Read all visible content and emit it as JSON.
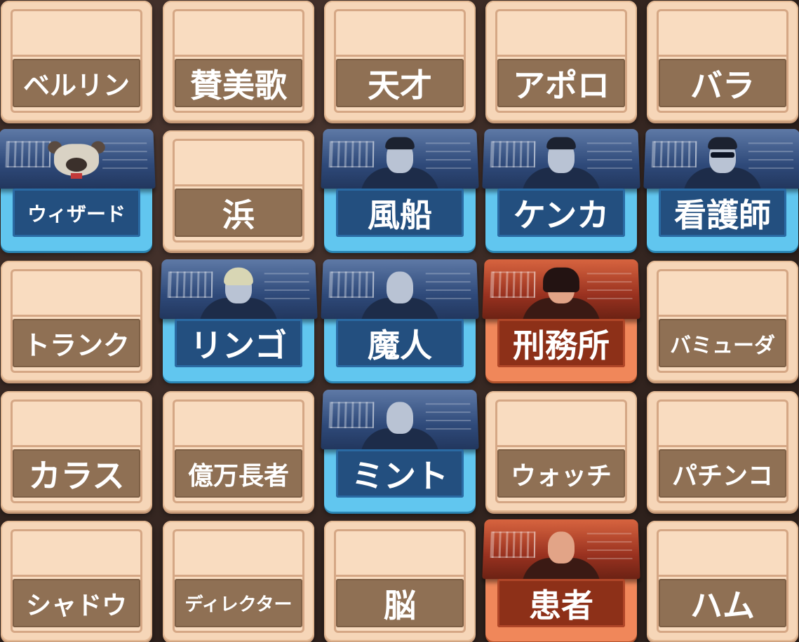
{
  "board": {
    "cards": [
      {
        "word": "ベルリン",
        "type": "neutral",
        "size": 38
      },
      {
        "word": "賛美歌",
        "type": "neutral",
        "size": 46
      },
      {
        "word": "天才",
        "type": "neutral",
        "size": 46
      },
      {
        "word": "アポロ",
        "type": "neutral",
        "size": 46
      },
      {
        "word": "バラ",
        "type": "neutral",
        "size": 46
      },
      {
        "word": "ウィザード",
        "type": "blue",
        "agent": "dog",
        "size": 28
      },
      {
        "word": "浜",
        "type": "neutral",
        "size": 46
      },
      {
        "word": "風船",
        "type": "blue",
        "agent": "man-suit",
        "size": 46
      },
      {
        "word": "ケンカ",
        "type": "blue",
        "agent": "woman-jacket",
        "size": 46
      },
      {
        "word": "看護師",
        "type": "blue",
        "agent": "man-shades",
        "size": 46
      },
      {
        "word": "トランク",
        "type": "neutral",
        "size": 38
      },
      {
        "word": "リンゴ",
        "type": "blue",
        "agent": "blonde-woman",
        "size": 46
      },
      {
        "word": "魔人",
        "type": "blue",
        "agent": "old-man",
        "size": 46
      },
      {
        "word": "刑務所",
        "type": "red",
        "agent": "bob-woman",
        "size": 46
      },
      {
        "word": "バミューダ",
        "type": "neutral",
        "size": 30
      },
      {
        "word": "カラス",
        "type": "neutral",
        "size": 46
      },
      {
        "word": "億万長者",
        "type": "neutral",
        "size": 36
      },
      {
        "word": "ミント",
        "type": "blue",
        "agent": "bald-man",
        "size": 46
      },
      {
        "word": "ウォッチ",
        "type": "neutral",
        "size": 36
      },
      {
        "word": "パチンコ",
        "type": "neutral",
        "size": 36
      },
      {
        "word": "シャドウ",
        "type": "neutral",
        "size": 36
      },
      {
        "word": "ディレクター",
        "type": "neutral",
        "size": 26
      },
      {
        "word": "脳",
        "type": "neutral",
        "size": 46
      },
      {
        "word": "患者",
        "type": "red",
        "agent": "bald-tie-man",
        "size": 46
      },
      {
        "word": "ハム",
        "type": "neutral",
        "size": 46
      }
    ]
  }
}
